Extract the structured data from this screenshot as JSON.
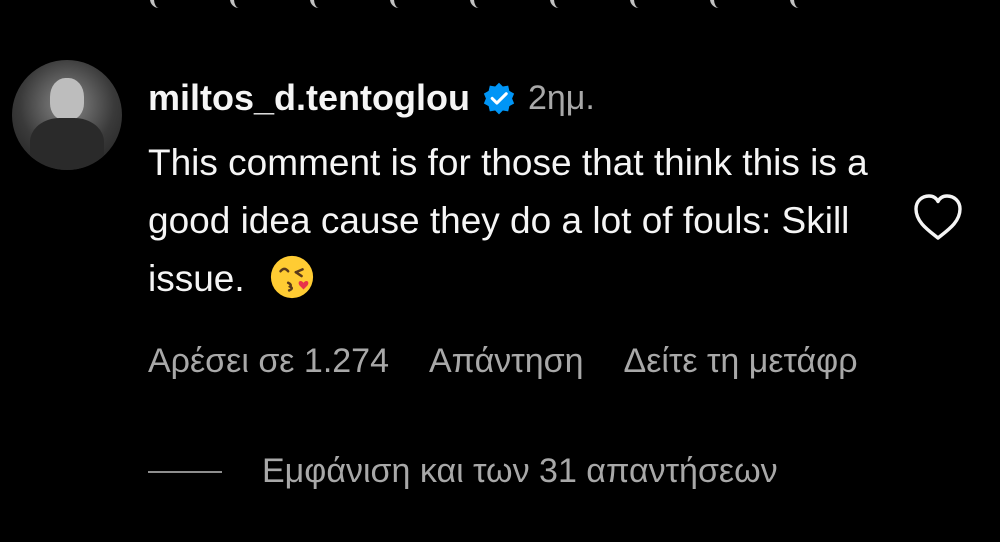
{
  "comment": {
    "username": "miltos_d.tentoglou",
    "time": "2ημ.",
    "text": "This comment is for those that think this is a good idea cause they do a lot of fouls: Skill issue.",
    "likes_label": "Αρέσει σε 1.274",
    "reply_label": "Απάντηση",
    "translate_label": "Δείτε τη μετάφρ",
    "view_replies_label": "Εμφάνιση και των 31 απαντήσεων"
  },
  "colors": {
    "background": "#000000",
    "text": "#f5f5f5",
    "muted": "#a8a8a8",
    "verified": "#0095f6",
    "emoji": "#ffcc33"
  },
  "icons": {
    "verified": "verified-badge-icon",
    "like": "heart-outline-icon",
    "emoji": "kissing-face-emoji"
  }
}
